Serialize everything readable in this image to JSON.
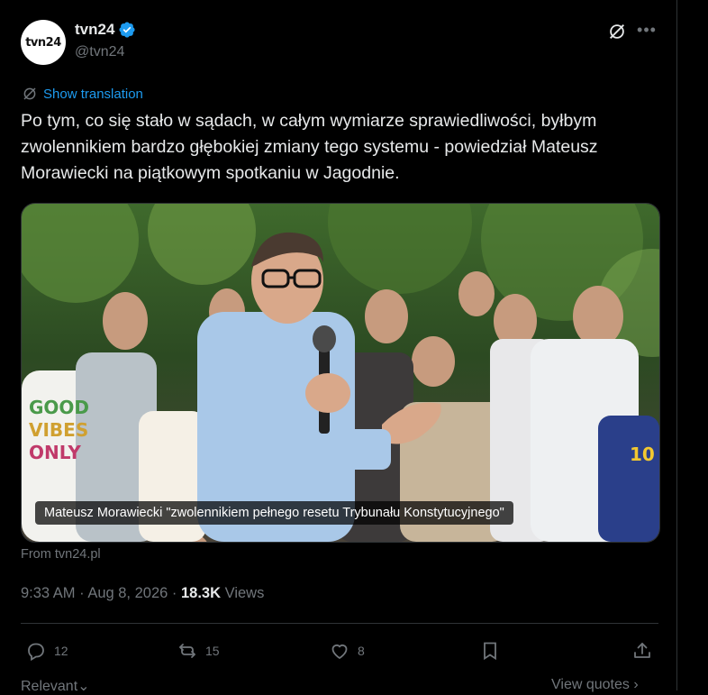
{
  "author": {
    "avatar_text": "tvn24",
    "display_name": "tvn24",
    "handle": "@tvn24"
  },
  "translate_label": "Show translation",
  "tweet_text": "Po tym, co się stało w sądach, w całym wymiarze sprawiedliwości, byłbym zwolennikiem bardzo głębokiej zmiany tego systemu - powiedział Mateusz Morawiecki na piątkowym spotkaniu w Jagodnie.",
  "card": {
    "caption": "Mateusz Morawiecki \"zwolennikiem pełnego resetu Trybunału Konstytucyjnego\"",
    "shirt_text": [
      "GOOD",
      "VIBES",
      "ONLY"
    ],
    "jersey_number": "10"
  },
  "source": "From tvn24.pl",
  "meta": {
    "time": "9:33 AM",
    "date": "Aug 8, 2026",
    "views_count": "18.3K",
    "views_label": "Views"
  },
  "actions": {
    "replies": "12",
    "reposts": "15",
    "likes": "8"
  },
  "footer": {
    "relevant": "Relevant",
    "view_quotes": "View quotes"
  },
  "colors": {
    "background": "#000000",
    "text": "#e7e9ea",
    "muted": "#71767b",
    "accent": "#1d9bf0",
    "border": "#2f3336"
  },
  "icons": {
    "verified": "verified-badge-icon",
    "grok": "grok-icon",
    "more": "more-icon",
    "reply": "reply-icon",
    "repost": "repost-icon",
    "like": "heart-icon",
    "bookmark": "bookmark-icon",
    "share": "share-icon"
  }
}
